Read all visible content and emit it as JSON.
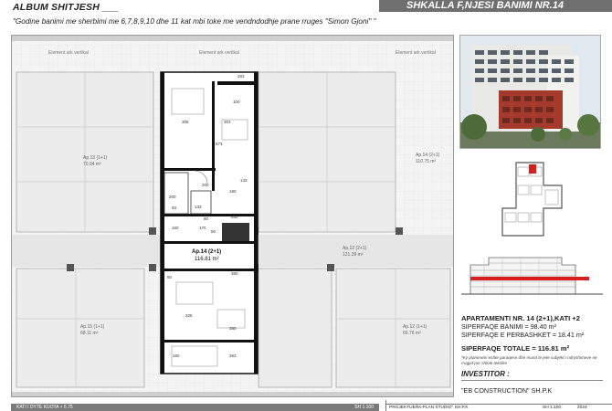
{
  "header": {
    "album_title": "ALBUM SHITJESH ___",
    "banner_title": "SHKALLA F,NJESI BANIMI NR.14",
    "subtitle": "\"Godine banimi me sherbimi me 6,7,8,9,10 dhe 11 kat mbi toke me vendndodhje prane rruges \"Simon Gjoni\" \""
  },
  "plan": {
    "element_labels": [
      "Element ark vertikal",
      "Element ark vertikal",
      "Element ark vertikal"
    ],
    "dimensions": [
      "283",
      "305",
      "303",
      "573",
      "380",
      "325",
      "200",
      "133",
      "160",
      "170",
      "180",
      "530",
      "60",
      "80",
      "50",
      "93",
      "133",
      "100",
      "200",
      "380",
      "363",
      "160"
    ],
    "neighbor_units": [
      {
        "name": "Ap.13 (1+1)",
        "area": "70.94 m²"
      },
      {
        "name": "Ap.14 (2+1)",
        "area": "110.75 m²"
      },
      {
        "name": "Ap.12 (2+1)",
        "area": "121.39 m²"
      },
      {
        "name": "Ap.15 (1+1)",
        "area": "68.11 m²"
      },
      {
        "name": "Ap.12 (1+1)",
        "area": "66.76 m²"
      }
    ],
    "highlighted_unit": {
      "name": "Ap.14  (2+1)",
      "area": "116.81 m²"
    }
  },
  "info": {
    "apartment": "APARTAMENTI NR. 14 (2+1),KATI +2",
    "residential_area": "SIPERFAQE BANIMI = 98.40 m²",
    "shared_area": "SIPERFAQE E PERBASHKET = 18.41 m²",
    "total_area": "SIPERFAQE TOTALE = 116.81 m²",
    "note": "*Ky planimetri eshte paraqese dhe mund te jete subjekt i ndryshimeve ne rrugjet per shkak teknike",
    "investor_label": "INVESTITOR :",
    "investor_name": "\"EB CONSTRUCTION\" SH.P.K"
  },
  "footer": {
    "left_title": "KATI I DYTE KUOTA + 5.75",
    "left_scale": "SH 1:100",
    "projected_label": "PROJEKTUES :",
    "projected_name": "\"A-PLAN STUDIO\" SH.P.K",
    "scale": "SH 1:100",
    "year": "2024"
  },
  "colors": {
    "banner": "#6f6f6f",
    "highlight_red": "#d62020",
    "plan_grey": "#9a9a9a",
    "facade_red": "#a43a2c"
  }
}
